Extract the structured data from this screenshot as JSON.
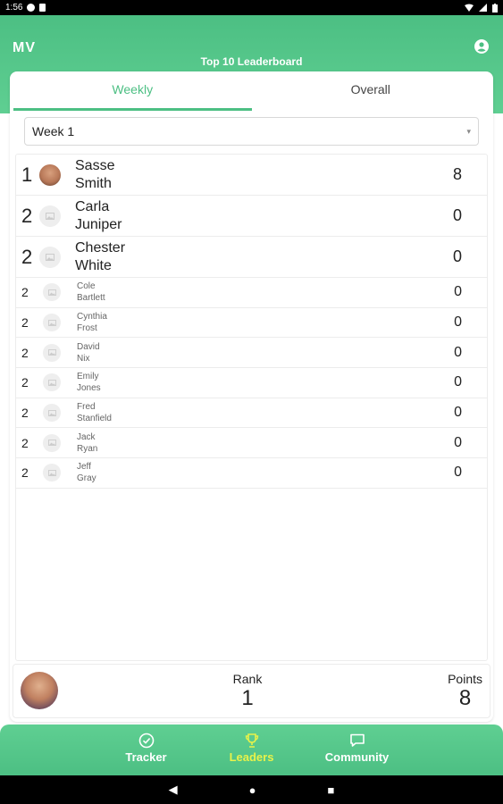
{
  "statusbar": {
    "time": "1:56"
  },
  "header": {
    "logo": "MV",
    "title": "Top 10 Leaderboard"
  },
  "tabs": [
    {
      "label": "Weekly"
    },
    {
      "label": "Overall"
    }
  ],
  "week_select": {
    "value": "Week 1"
  },
  "rows": [
    {
      "rank": "1",
      "first": "Sasse",
      "last": "Smith",
      "points": "8"
    },
    {
      "rank": "2",
      "first": "Carla",
      "last": "Juniper",
      "points": "0"
    },
    {
      "rank": "2",
      "first": "Chester",
      "last": "White",
      "points": "0"
    },
    {
      "rank": "2",
      "first": "Cole",
      "last": "Bartlett",
      "points": "0"
    },
    {
      "rank": "2",
      "first": "Cynthia",
      "last": "Frost",
      "points": "0"
    },
    {
      "rank": "2",
      "first": "David",
      "last": "Nix",
      "points": "0"
    },
    {
      "rank": "2",
      "first": "Emily",
      "last": "Jones",
      "points": "0"
    },
    {
      "rank": "2",
      "first": "Fred",
      "last": "Stanfield",
      "points": "0"
    },
    {
      "rank": "2",
      "first": "Jack",
      "last": "Ryan",
      "points": "0"
    },
    {
      "rank": "2",
      "first": "Jeff",
      "last": "Gray",
      "points": "0"
    }
  ],
  "summary": {
    "rank_label": "Rank",
    "rank_value": "1",
    "points_label": "Points",
    "points_value": "8"
  },
  "nav": [
    {
      "label": "Tracker",
      "icon": "check-circle-icon"
    },
    {
      "label": "Leaders",
      "icon": "trophy-icon"
    },
    {
      "label": "Community",
      "icon": "chat-bubble-icon"
    }
  ],
  "colors": {
    "brand_green": "#4cbf83",
    "active_nav": "#e8f24a"
  }
}
